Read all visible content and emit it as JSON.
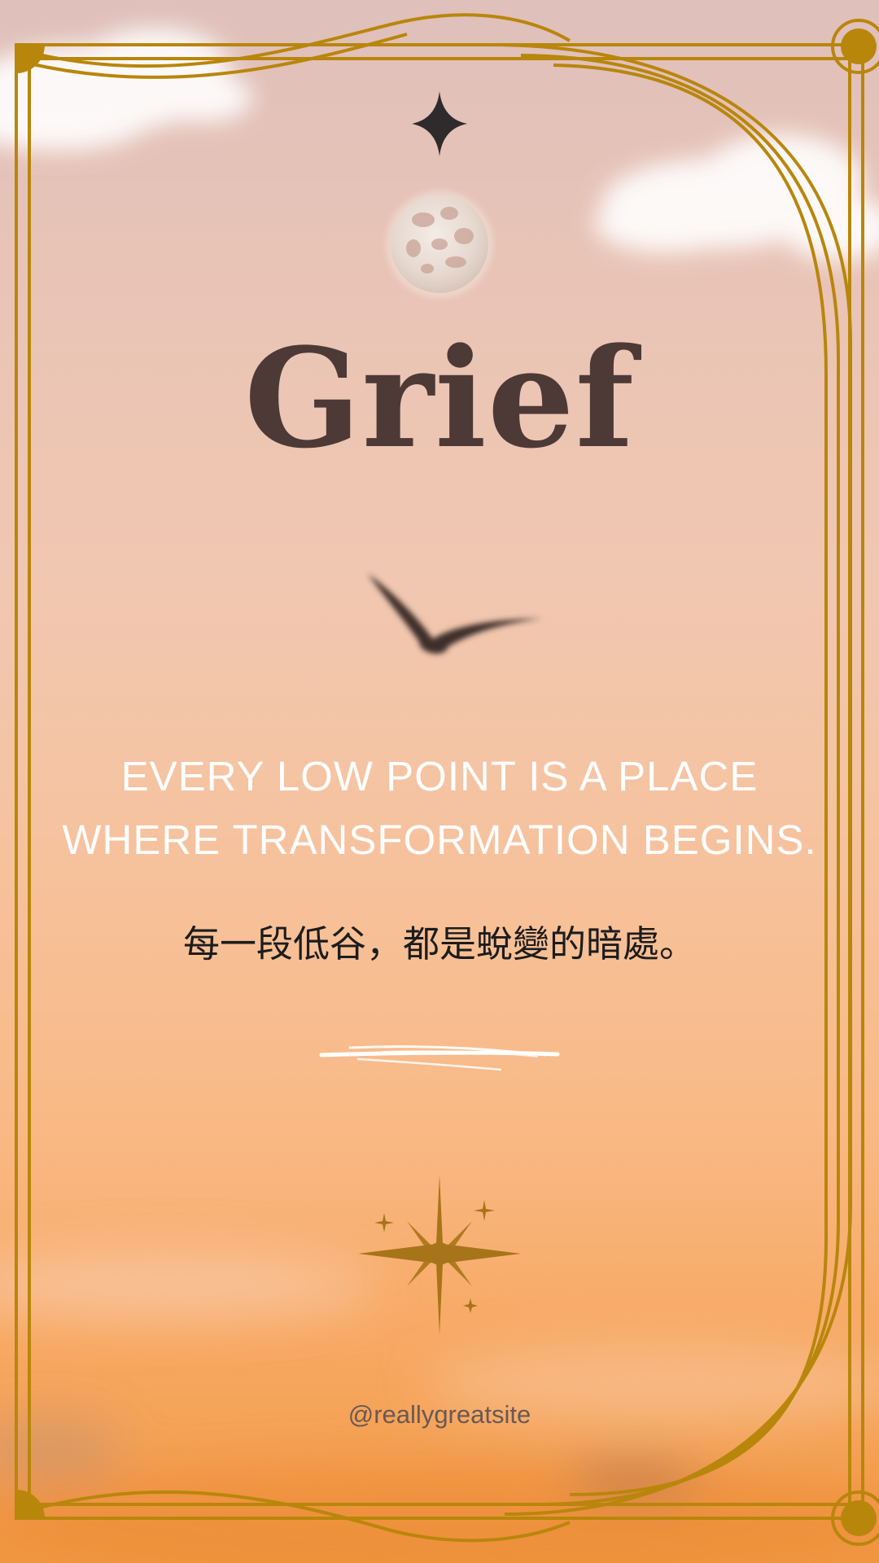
{
  "poster": {
    "title": "Grief",
    "quote_lines": [
      "EVERY LOW POINT IS A PLACE",
      "WHERE TRANSFORMATION BEGINS."
    ],
    "quote_zh": "每一段低谷，都是蛻變的暗處。",
    "handle": "@reallygreatsite"
  },
  "colors": {
    "frame_gold": "#b8860b",
    "title_brown": "#4d3a36",
    "quote_white": "#ffffff",
    "sky_top": "#dfc0bb",
    "sky_bottom": "#f19a45"
  },
  "icons": [
    "four-point-star-icon",
    "moon-icon",
    "bird-silhouette",
    "sparkle-cluster-icon",
    "brush-stroke"
  ]
}
